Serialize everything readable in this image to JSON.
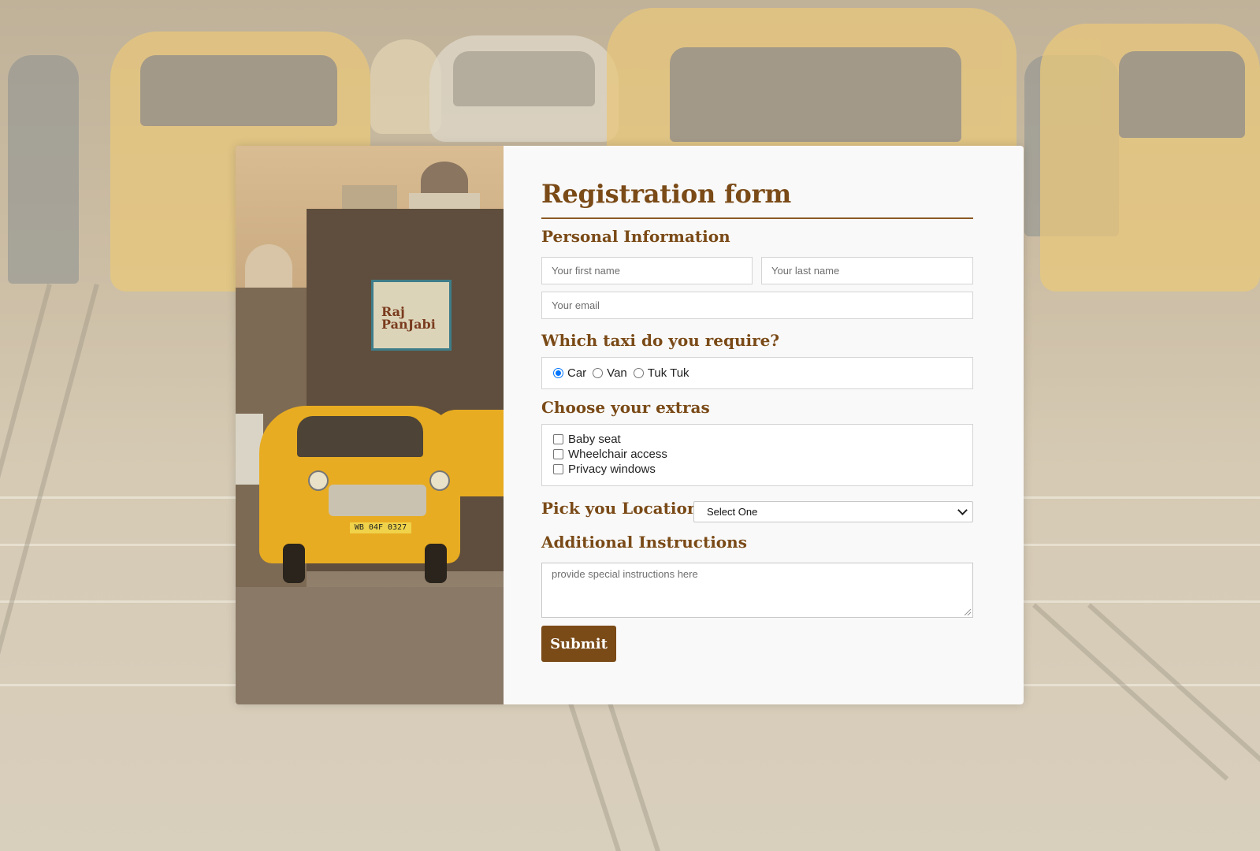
{
  "form": {
    "title": "Registration form",
    "personal_heading": "Personal Information",
    "first_name_placeholder": "Your first name",
    "last_name_placeholder": "Your last name",
    "email_placeholder": "Your email",
    "taxi_heading": "Which taxi do you require?",
    "taxi_options": [
      {
        "label": "Car",
        "checked": true
      },
      {
        "label": "Van",
        "checked": false
      },
      {
        "label": "Tuk Tuk",
        "checked": false
      }
    ],
    "extras_heading": "Choose your extras",
    "extras": [
      {
        "label": "Baby seat",
        "checked": false
      },
      {
        "label": "Wheelchair access",
        "checked": false
      },
      {
        "label": "Privacy windows",
        "checked": false
      }
    ],
    "location_heading": "Pick you Location",
    "location_selected": "Select One",
    "instructions_heading": "Additional Instructions",
    "instructions_placeholder": "provide special instructions here",
    "submit_label": "Submit"
  },
  "photo": {
    "poster_text": "Raj\nPanJabi",
    "plate_text": "WB 04F 0327"
  },
  "colors": {
    "accent": "#7a4a17",
    "radio_checked": "#0075ff",
    "card_bg": "#f9f9f9"
  }
}
